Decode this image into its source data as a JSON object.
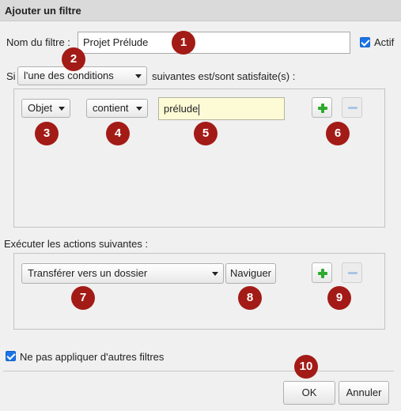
{
  "window": {
    "title": "Ajouter un filtre"
  },
  "filter_name": {
    "label": "Nom du filtre :",
    "value": "Projet Prélude"
  },
  "active": {
    "label": "Actif",
    "checked": true
  },
  "match": {
    "prefix": "Si",
    "mode": "l'une des conditions",
    "suffix": "suivantes est/sont satisfaite(s) :"
  },
  "condition": {
    "field": "Objet",
    "operator": "contient",
    "value": "prélude"
  },
  "actions": {
    "label": "Exécuter les actions suivantes :",
    "action": "Transférer vers un dossier",
    "browse": "Naviguer"
  },
  "stop_processing": {
    "label": "Ne pas appliquer d'autres filtres",
    "checked": true
  },
  "footer": {
    "ok": "OK",
    "cancel": "Annuler"
  },
  "callouts": [
    "1",
    "2",
    "3",
    "4",
    "5",
    "6",
    "7",
    "8",
    "9",
    "10"
  ],
  "colors": {
    "callout": "#a31b16",
    "accent": "#1a73e8",
    "add": "#2eaa2e"
  }
}
